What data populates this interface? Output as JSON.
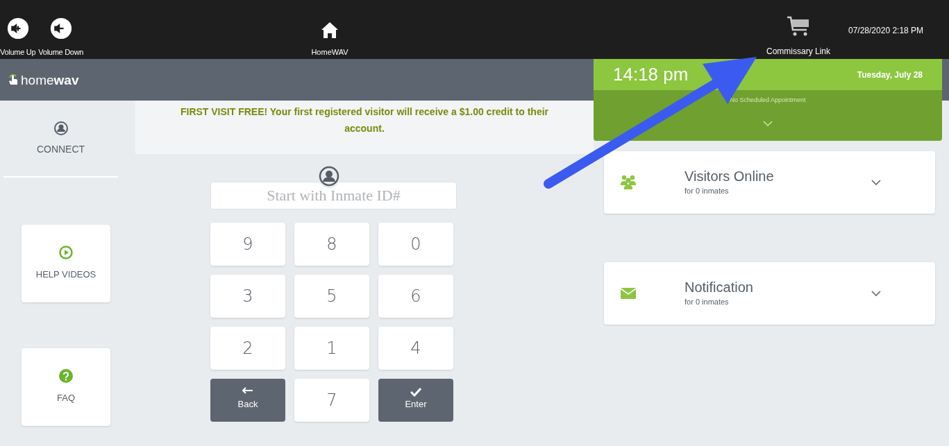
{
  "top_bar": {
    "buttons": [
      {
        "label": "Volume Up",
        "kind": "volume-up"
      },
      {
        "label": "Volume Down",
        "kind": "volume-down"
      }
    ],
    "home": {
      "label": "HomeWAV"
    },
    "commissary": {
      "label": "Commissary Link"
    },
    "datetime": "07/28/2020 2:18 PM"
  },
  "header": {
    "logo": "home**wav**"
  },
  "sidebar": {
    "items": [
      {
        "label": "CONNECT",
        "kind": "connect"
      },
      {
        "label": "HELP VIDEOS",
        "kind": "help"
      },
      {
        "label": "FAQ",
        "kind": "faq"
      }
    ]
  },
  "banner": "FIRST VISIT FREE! Your first registered visitor will receive a $1.00 credit to their account.",
  "inmate_field": {
    "placeholder": "Start with Inmate ID#"
  },
  "keypad": {
    "rows": [
      [
        {
          "label": "9",
          "kind": "digit"
        },
        {
          "label": "8",
          "kind": "digit"
        },
        {
          "label": "0",
          "kind": "digit"
        }
      ],
      [
        {
          "label": "3",
          "kind": "digit"
        },
        {
          "label": "5",
          "kind": "digit"
        },
        {
          "label": "6",
          "kind": "digit"
        }
      ],
      [
        {
          "label": "2",
          "kind": "digit"
        },
        {
          "label": "1",
          "kind": "digit"
        },
        {
          "label": "4",
          "kind": "digit"
        }
      ],
      [
        {
          "label": "Back",
          "kind": "back"
        },
        {
          "label": "7",
          "kind": "digit"
        },
        {
          "label": "Enter",
          "kind": "enter"
        }
      ]
    ]
  },
  "schedule": {
    "time": "14:18 pm",
    "date": "Tuesday, July 28",
    "appointment": "No Scheduled Appointment"
  },
  "cards": [
    {
      "title": "Visitors Online",
      "subtitle": "for 0 inmates",
      "kind": "visitors"
    },
    {
      "title": "Notification",
      "subtitle": "for 0 inmates",
      "kind": "notification"
    }
  ]
}
